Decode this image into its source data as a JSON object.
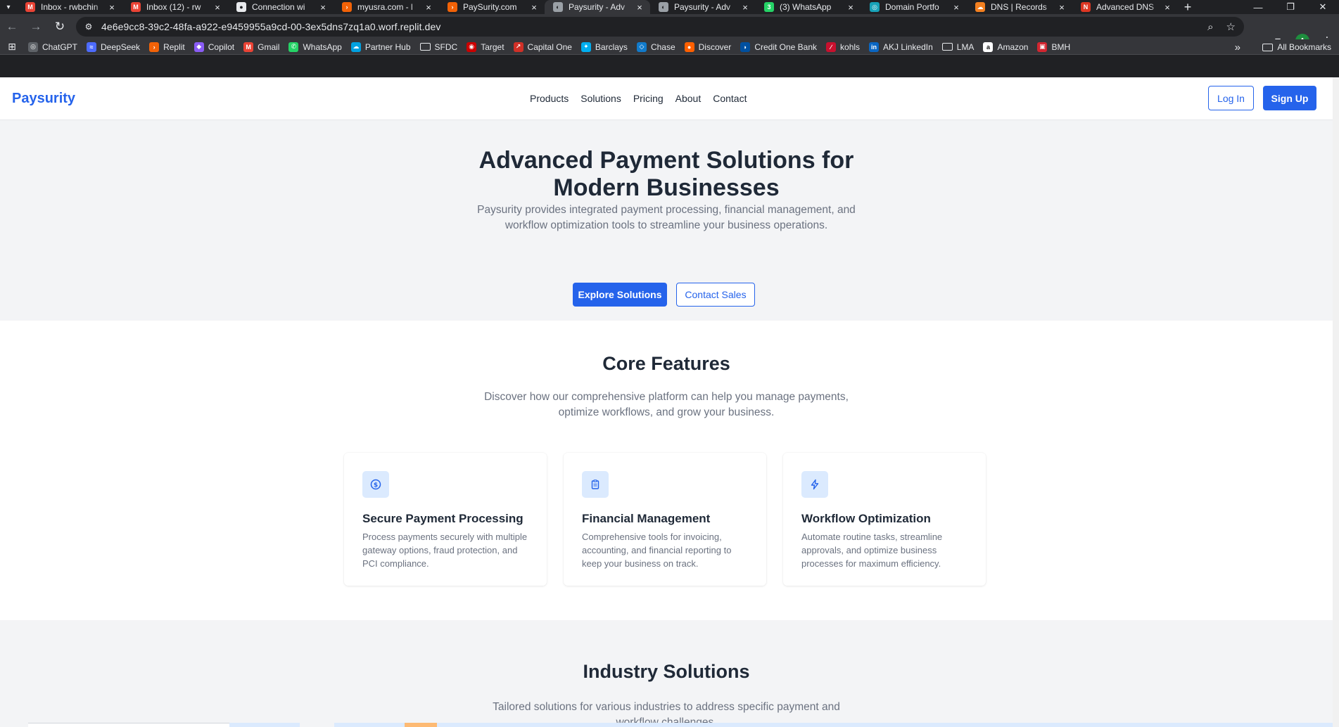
{
  "browser": {
    "tabs": [
      {
        "title": "Inbox - rwbchin",
        "icon": "gmail-icon",
        "color": "#ea4335",
        "glyph": "M"
      },
      {
        "title": "Inbox (12) - rw",
        "icon": "gmail-icon",
        "color": "#ea4335",
        "glyph": "M"
      },
      {
        "title": "Connection wi",
        "icon": "github-icon",
        "color": "#e8eaed",
        "glyph": "●"
      },
      {
        "title": "myusra.com - l",
        "icon": "replit-icon",
        "color": "#f26207",
        "glyph": "›"
      },
      {
        "title": "PaySurity.com",
        "icon": "replit-icon",
        "color": "#f26207",
        "glyph": "›"
      },
      {
        "title": "Paysurity - Adv",
        "icon": "globe-icon",
        "color": "#9aa0a6",
        "glyph": "◐",
        "active": true
      },
      {
        "title": "Paysurity - Adv",
        "icon": "globe-icon",
        "color": "#9aa0a6",
        "glyph": "◐"
      },
      {
        "title": "(3) WhatsApp",
        "icon": "whatsapp-icon",
        "color": "#25d366",
        "glyph": "3"
      },
      {
        "title": "Domain Portfo",
        "icon": "domain-icon",
        "color": "#17a2b8",
        "glyph": "◎"
      },
      {
        "title": "DNS | Records",
        "icon": "cloudflare-icon",
        "color": "#f38020",
        "glyph": "☁"
      },
      {
        "title": "Advanced DNS",
        "icon": "namecheap-icon",
        "color": "#de3723",
        "glyph": "N"
      }
    ],
    "url": "4e6e9cc8-39c2-48fa-a922-e9459955a9cd-00-3ex5dns7zq1a0.worf.replit.dev",
    "profile_initial": "A",
    "bookmarks": [
      {
        "label": "ChatGPT",
        "icon": "chatgpt-icon",
        "color": "#5f6368",
        "glyph": "◎"
      },
      {
        "label": "DeepSeek",
        "icon": "deepseek-icon",
        "color": "#4d6bfe",
        "glyph": "≈"
      },
      {
        "label": "Replit",
        "icon": "replit-icon",
        "color": "#f26207",
        "glyph": "›"
      },
      {
        "label": "Copilot",
        "icon": "copilot-icon",
        "color": "#8a5cf5",
        "glyph": "◆"
      },
      {
        "label": "Gmail",
        "icon": "gmail-icon",
        "color": "#ea4335",
        "glyph": "M"
      },
      {
        "label": "WhatsApp",
        "icon": "whatsapp-icon",
        "color": "#25d366",
        "glyph": "✆"
      },
      {
        "label": "Partner Hub",
        "icon": "partner-hub-icon",
        "color": "#00a1e0",
        "glyph": "☁"
      },
      {
        "label": "SFDC",
        "icon": "folder-icon",
        "folder": true
      },
      {
        "label": "Target",
        "icon": "target-icon",
        "color": "#cc0000",
        "glyph": "◉"
      },
      {
        "label": "Capital One",
        "icon": "capital-one-icon",
        "color": "#d03027",
        "glyph": "↗"
      },
      {
        "label": "Barclays",
        "icon": "barclays-icon",
        "color": "#00aeef",
        "glyph": "✦"
      },
      {
        "label": "Chase",
        "icon": "chase-icon",
        "color": "#117aca",
        "glyph": "◇"
      },
      {
        "label": "Discover",
        "icon": "discover-icon",
        "color": "#ff6000",
        "glyph": "●"
      },
      {
        "label": "Credit One Bank",
        "icon": "credit-one-icon",
        "color": "#0050a0",
        "glyph": "◗"
      },
      {
        "label": "kohls",
        "icon": "kohls-icon",
        "color": "#c8102e",
        "glyph": "∕"
      },
      {
        "label": "AKJ LinkedIn",
        "icon": "linkedin-icon",
        "color": "#0a66c2",
        "glyph": "in"
      },
      {
        "label": "LMA",
        "icon": "folder-icon",
        "folder": true
      },
      {
        "label": "Amazon",
        "icon": "amazon-icon",
        "color": "#ffffff",
        "glyph": "a",
        "dark": true
      },
      {
        "label": "BMH",
        "icon": "bmh-icon",
        "color": "#d22630",
        "glyph": "▣"
      }
    ],
    "all_bookmarks": "All Bookmarks"
  },
  "site": {
    "logo": "Paysurity",
    "nav": [
      "Products",
      "Solutions",
      "Pricing",
      "About",
      "Contact"
    ],
    "login": "Log In",
    "signup": "Sign Up"
  },
  "hero": {
    "title": "Advanced Payment Solutions for Modern Businesses",
    "subtitle": "Paysurity provides integrated payment processing, financial management, and workflow optimization tools to streamline your business operations.",
    "primary_cta": "Explore Solutions",
    "secondary_cta": "Contact Sales"
  },
  "features": {
    "title": "Core Features",
    "subtitle": "Discover how our comprehensive platform can help you manage payments, optimize workflows, and grow your business.",
    "cards": [
      {
        "icon": "dollar-circle-icon",
        "title": "Secure Payment Processing",
        "text": "Process payments securely with multiple gateway options, fraud protection, and PCI compliance."
      },
      {
        "icon": "clipboard-icon",
        "title": "Financial Management",
        "text": "Comprehensive tools for invoicing, accounting, and financial reporting to keep your business on track."
      },
      {
        "icon": "lightning-icon",
        "title": "Workflow Optimization",
        "text": "Automate routine tasks, streamline approvals, and optimize business processes for maximum efficiency."
      }
    ]
  },
  "industry": {
    "title": "Industry Solutions",
    "subtitle": "Tailored solutions for various industries to address specific payment and workflow challenges."
  },
  "colors": {
    "brand": "#2563eb",
    "text": "#1f2937",
    "muted": "#6b7280",
    "section_bg": "#f3f4f6",
    "icon_bg": "#dbeafe"
  }
}
